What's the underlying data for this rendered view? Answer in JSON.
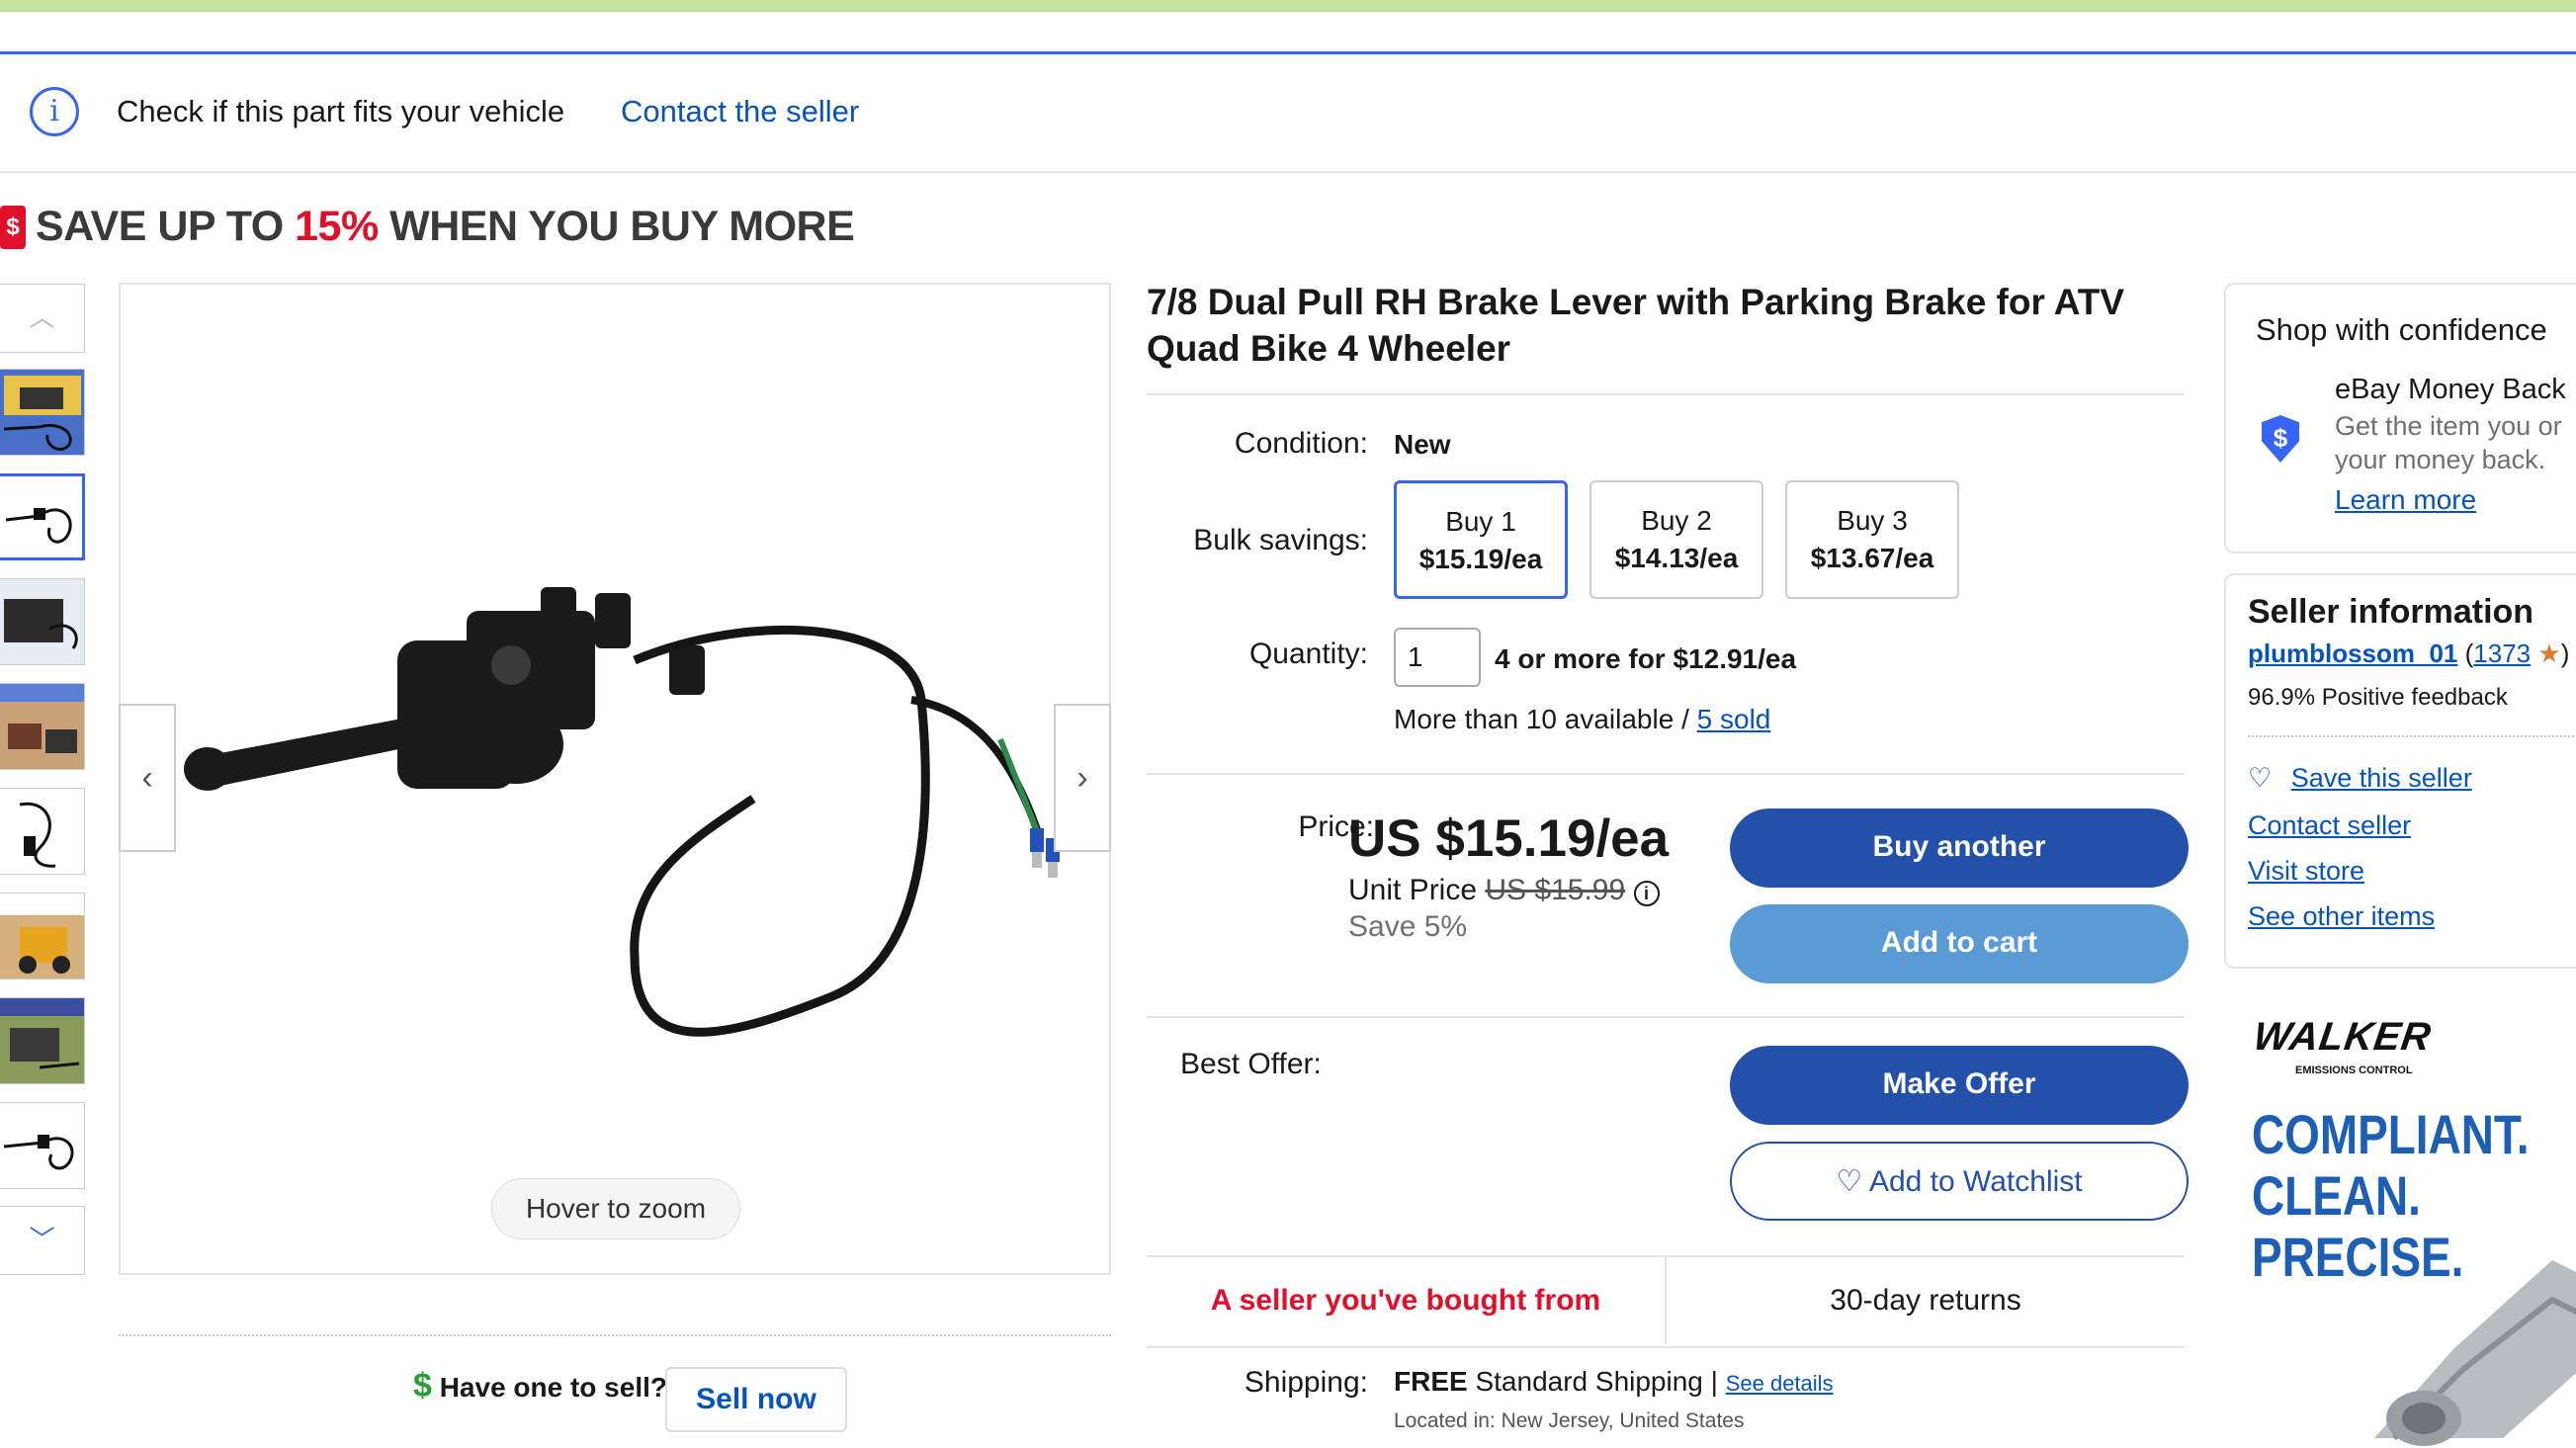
{
  "fit_bar": {
    "check_text": "Check if this part fits your vehicle",
    "contact_seller": "Contact the seller"
  },
  "banner": {
    "prefix": "SAVE UP TO ",
    "percent": "15%",
    "suffix": " WHEN YOU BUY MORE"
  },
  "gallery": {
    "hover_to_zoom": "Hover to zoom",
    "thumbnail_count": 8,
    "selected_index": 1
  },
  "sell": {
    "question": "Have one to sell?",
    "button": "Sell now"
  },
  "item": {
    "title": "7/8 Dual Pull RH Brake Lever with Parking Brake for ATV Quad Bike 4 Wheeler",
    "condition_label": "Condition:",
    "condition_value": "New",
    "bulk_label": "Bulk savings:",
    "bulk_options": [
      {
        "qty": "Buy 1",
        "price": "$15.19/ea"
      },
      {
        "qty": "Buy 2",
        "price": "$14.13/ea"
      },
      {
        "qty": "Buy 3",
        "price": "$13.67/ea"
      }
    ],
    "quantity_label": "Quantity:",
    "quantity_value": "1",
    "quantity_deal": "4 or more for $12.91/ea",
    "availability": "More than 10 available / ",
    "sold": "5 sold",
    "price_label": "Price:",
    "price": "US $15.19/ea",
    "unit_price_label": "Unit Price ",
    "unit_price_strike": "US $15.99",
    "save": "Save 5%",
    "buy_another": "Buy another",
    "add_to_cart": "Add to cart",
    "best_offer_label": "Best Offer:",
    "make_offer": "Make Offer",
    "add_to_watchlist": "Add to Watchlist",
    "seller_bought": "A seller you've bought from",
    "returns": "30-day returns",
    "shipping_label": "Shipping:",
    "shipping_free": "FREE",
    "shipping_type": " Standard Shipping | ",
    "see_details": "See details",
    "located": "Located in: New Jersey, United States"
  },
  "confidence": {
    "title": "Shop with confidence",
    "mbg_title": "eBay Money Back",
    "mbg_line1": "Get the item you or",
    "mbg_line2": "your money back.",
    "learn_more": "Learn more"
  },
  "seller": {
    "title": "Seller information",
    "name": "plumblossom_01",
    "feedback_count": "1373",
    "positive": "96.9% Positive feedback",
    "save_seller": "Save this seller",
    "contact": "Contact seller",
    "visit_store": "Visit store",
    "other_items": "See other items"
  },
  "ad": {
    "brand": "WALKER",
    "brand_sub": "EMISSIONS CONTROL",
    "line1": "COMPLIANT.",
    "line2": "CLEAN.",
    "line3": "PRECISE."
  },
  "colors": {
    "ebay_blue": "#3665f3",
    "link": "#0654ba",
    "button_blue": "#2350a8",
    "button_light": "#5a9bd5",
    "red": "#e0102b"
  }
}
